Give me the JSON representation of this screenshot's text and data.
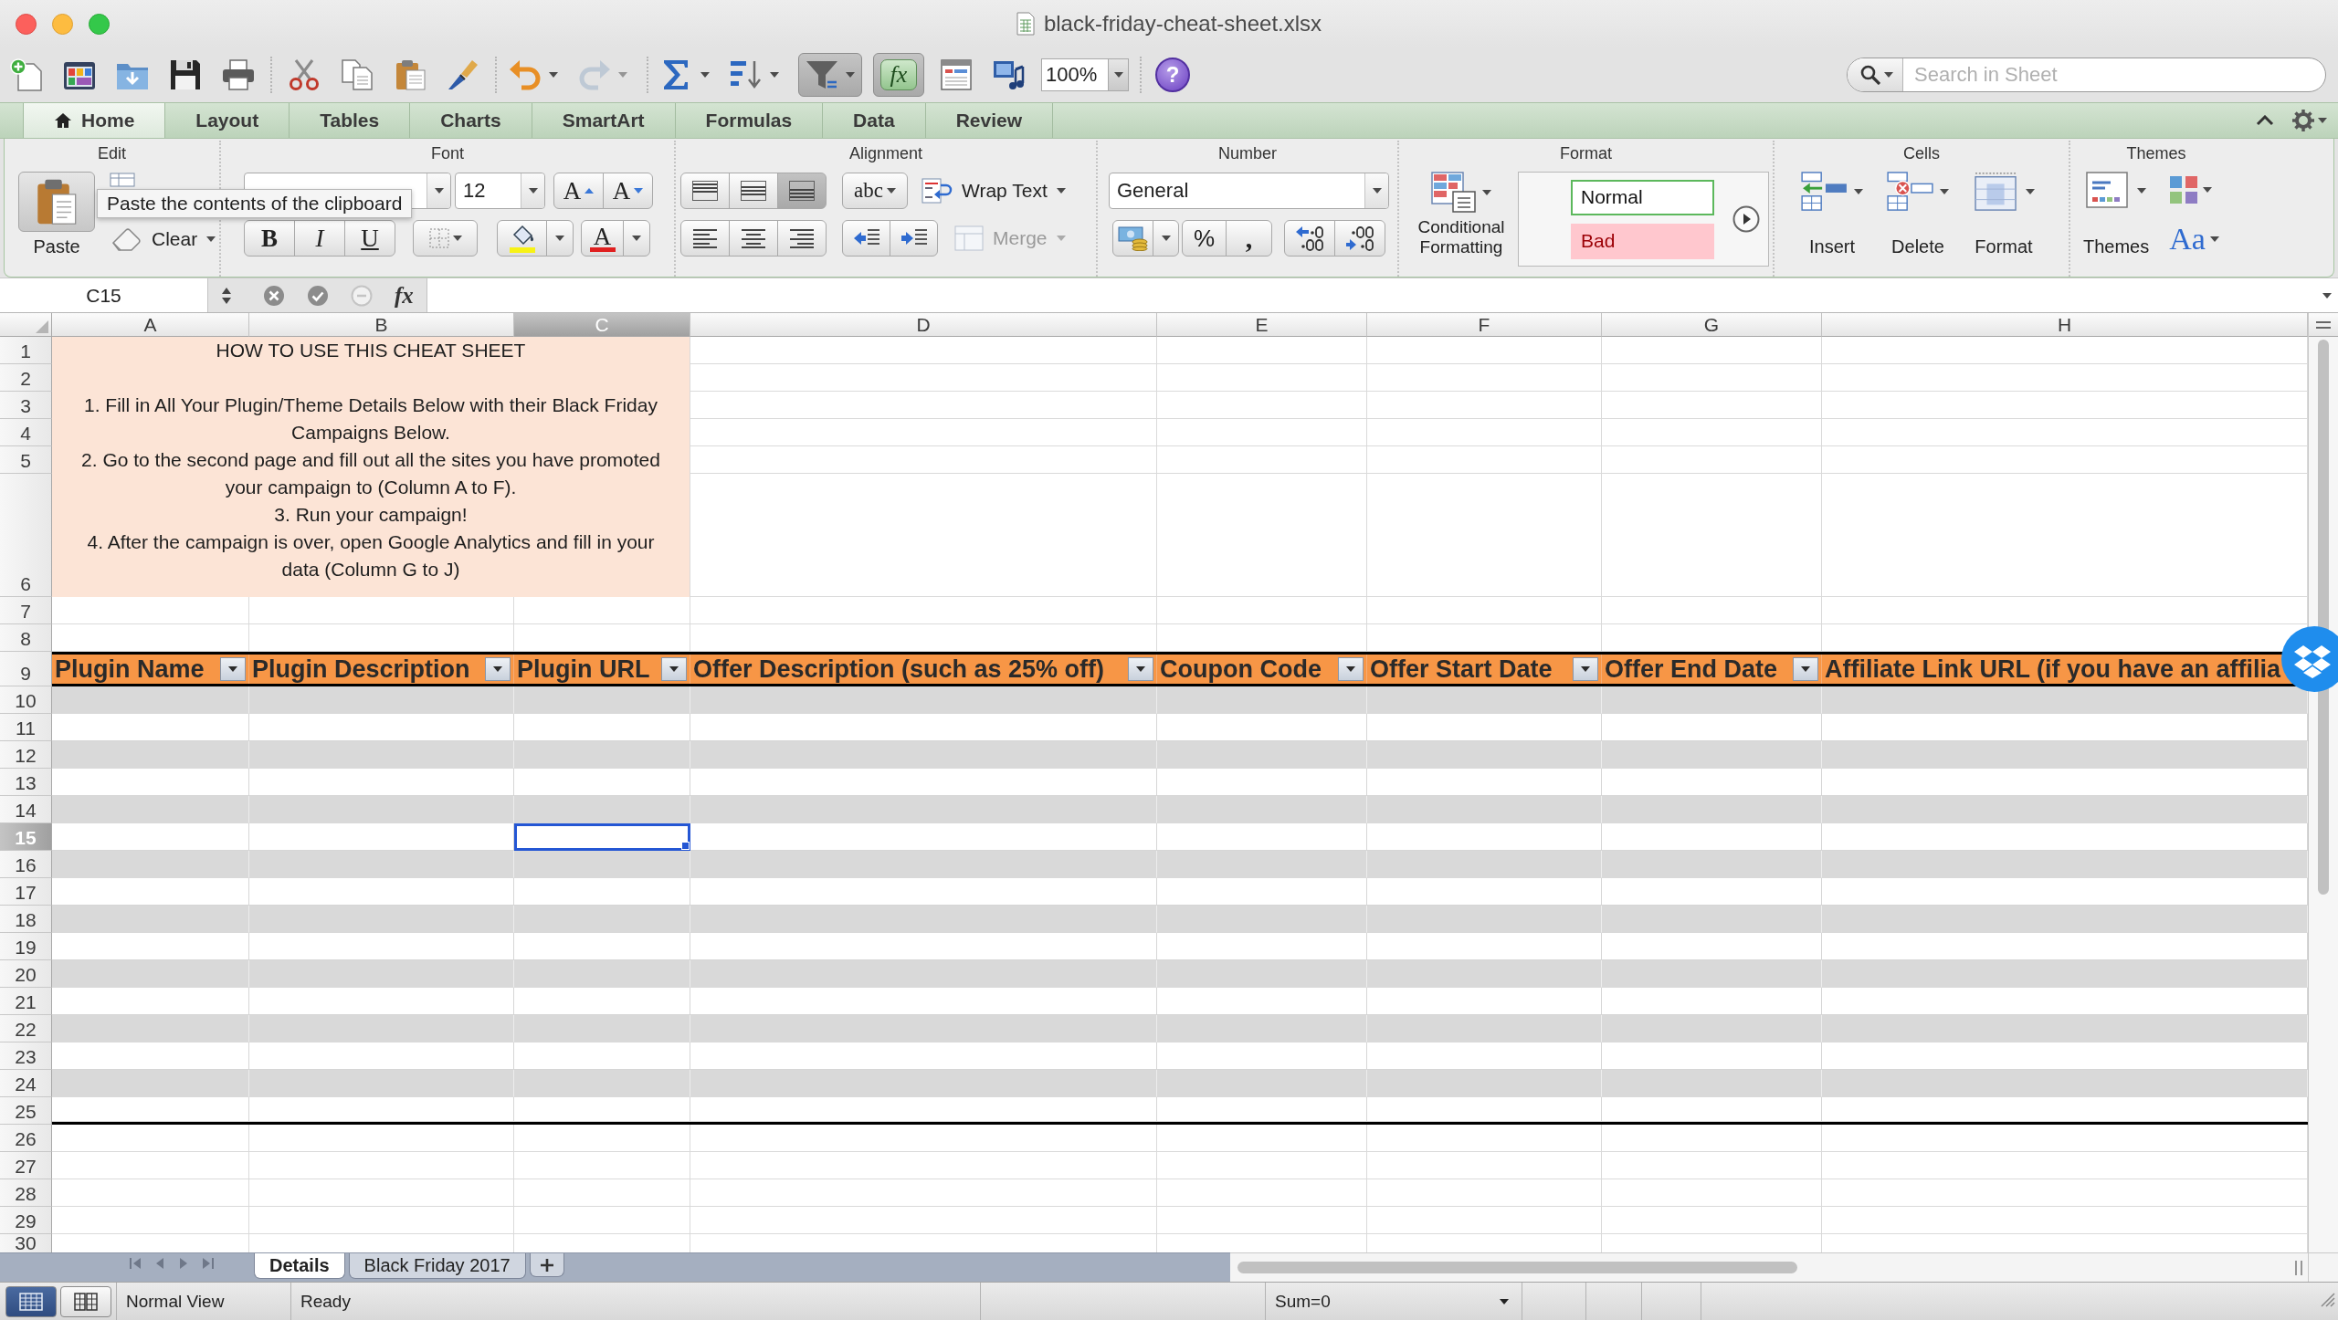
{
  "window": {
    "title": "black-friday-cheat-sheet.xlsx"
  },
  "toolbar": {
    "items": [
      {
        "kind": "new",
        "pressed": false,
        "disabled": false,
        "menu": false
      },
      {
        "kind": "gallery",
        "pressed": false,
        "disabled": false,
        "menu": false
      },
      {
        "kind": "open",
        "pressed": false,
        "disabled": false,
        "menu": false
      },
      {
        "kind": "save",
        "pressed": false,
        "disabled": false,
        "menu": false
      },
      {
        "kind": "print",
        "pressed": false,
        "disabled": false,
        "menu": false
      },
      {
        "kind": "separator"
      },
      {
        "kind": "cut",
        "pressed": false,
        "disabled": false,
        "menu": false
      },
      {
        "kind": "copy",
        "pressed": false,
        "disabled": false,
        "menu": false
      },
      {
        "kind": "paste",
        "pressed": false,
        "disabled": false,
        "menu": false
      },
      {
        "kind": "format-painter",
        "pressed": false,
        "disabled": false,
        "menu": false
      },
      {
        "kind": "separator"
      },
      {
        "kind": "undo",
        "pressed": false,
        "disabled": false,
        "menu": true
      },
      {
        "kind": "redo",
        "pressed": false,
        "disabled": true,
        "menu": true
      },
      {
        "kind": "separator"
      },
      {
        "kind": "sum",
        "pressed": false,
        "disabled": false,
        "menu": true
      },
      {
        "kind": "sort",
        "pressed": false,
        "disabled": false,
        "menu": true
      },
      {
        "kind": "filter",
        "pressed": true,
        "disabled": false,
        "menu": true
      },
      {
        "kind": "formula-builder",
        "label": "fx",
        "pressed": true,
        "disabled": false,
        "menu": false
      },
      {
        "kind": "toolbox",
        "pressed": false,
        "disabled": false,
        "menu": false
      },
      {
        "kind": "media",
        "pressed": false,
        "disabled": false,
        "menu": false
      },
      {
        "kind": "zoom",
        "value": "100%"
      },
      {
        "kind": "separator"
      },
      {
        "kind": "help",
        "label": "?",
        "pressed": false,
        "disabled": false,
        "menu": false
      }
    ],
    "search": {
      "placeholder": "Search in Sheet"
    }
  },
  "ribbon": {
    "tabs": [
      {
        "label": "Home",
        "selected": true
      },
      {
        "label": "Layout",
        "selected": false
      },
      {
        "label": "Tables",
        "selected": false
      },
      {
        "label": "Charts",
        "selected": false
      },
      {
        "label": "SmartArt",
        "selected": false
      },
      {
        "label": "Formulas",
        "selected": false
      },
      {
        "label": "Data",
        "selected": false
      },
      {
        "label": "Review",
        "selected": false
      }
    ],
    "edit": {
      "title": "Edit",
      "paste": "Paste",
      "clear": "Clear"
    },
    "font": {
      "title": "Font",
      "size": "12",
      "grow": "A",
      "shrink": "A",
      "bold": "B",
      "italic": "I",
      "underline": "U",
      "font_color_letter": "A"
    },
    "alignment": {
      "title": "Alignment",
      "vertical": [
        {
          "selected": false
        },
        {
          "selected": false
        },
        {
          "selected": true
        }
      ],
      "orientation": "abc",
      "wrap_text": "Wrap Text",
      "merge": {
        "label": "Merge",
        "disabled": true
      }
    },
    "number": {
      "title": "Number",
      "format": "General",
      "percent": "%",
      "comma": ","
    },
    "format": {
      "title": "Format",
      "conditional": "Conditional Formatting",
      "styles": [
        {
          "label": "Normal",
          "kind": "normal",
          "selected": true
        },
        {
          "label": "Bad",
          "kind": "bad",
          "selected": false
        }
      ]
    },
    "cells": {
      "title": "Cells",
      "buttons": [
        {
          "label": "Insert",
          "kind": "insert"
        },
        {
          "label": "Delete",
          "kind": "delete"
        },
        {
          "label": "Format",
          "kind": "format"
        }
      ]
    },
    "themes": {
      "title": "Themes",
      "themes": "Themes",
      "fonts": "Aa"
    }
  },
  "tooltip": "Paste the contents of the clipboard",
  "formula_bar": {
    "name_box": "C15",
    "function_button": "fx"
  },
  "sheet": {
    "columns": [
      {
        "label": "A",
        "selected": false
      },
      {
        "label": "B",
        "selected": false
      },
      {
        "label": "C",
        "selected": true
      },
      {
        "label": "D",
        "selected": false
      },
      {
        "label": "E",
        "selected": false
      },
      {
        "label": "F",
        "selected": false
      },
      {
        "label": "G",
        "selected": false
      },
      {
        "label": "H",
        "selected": false
      }
    ],
    "rows": [
      {
        "label": "1",
        "kind": "note",
        "selected": false
      },
      {
        "label": "2",
        "kind": "note",
        "selected": false
      },
      {
        "label": "3",
        "kind": "note",
        "selected": false
      },
      {
        "label": "4",
        "kind": "note",
        "selected": false
      },
      {
        "label": "5",
        "kind": "note",
        "selected": false
      },
      {
        "label": "6",
        "kind": "note",
        "selected": false
      },
      {
        "label": "7",
        "kind": "blank",
        "selected": false
      },
      {
        "label": "8",
        "kind": "blank",
        "selected": false
      },
      {
        "label": "9",
        "kind": "table-header",
        "selected": false
      },
      {
        "label": "10",
        "kind": "table-row",
        "selected": false
      },
      {
        "label": "11",
        "kind": "table-row",
        "selected": false
      },
      {
        "label": "12",
        "kind": "table-row",
        "selected": false
      },
      {
        "label": "13",
        "kind": "table-row",
        "selected": false
      },
      {
        "label": "14",
        "kind": "table-row",
        "selected": false
      },
      {
        "label": "15",
        "kind": "table-row",
        "selected": true
      },
      {
        "label": "16",
        "kind": "table-row",
        "selected": false
      },
      {
        "label": "17",
        "kind": "table-row",
        "selected": false
      },
      {
        "label": "18",
        "kind": "table-row",
        "selected": false
      },
      {
        "label": "19",
        "kind": "table-row",
        "selected": false
      },
      {
        "label": "20",
        "kind": "table-row",
        "selected": false
      },
      {
        "label": "21",
        "kind": "table-row",
        "selected": false
      },
      {
        "label": "22",
        "kind": "table-row",
        "selected": false
      },
      {
        "label": "23",
        "kind": "table-row",
        "selected": false
      },
      {
        "label": "24",
        "kind": "table-row",
        "selected": false
      },
      {
        "label": "25",
        "kind": "table-row",
        "selected": false
      },
      {
        "label": "26",
        "kind": "blank",
        "selected": false
      },
      {
        "label": "27",
        "kind": "blank",
        "selected": false
      },
      {
        "label": "28",
        "kind": "blank",
        "selected": false
      },
      {
        "label": "29",
        "kind": "blank",
        "selected": false
      },
      {
        "label": "30",
        "kind": "blank",
        "selected": false
      }
    ],
    "instructions": {
      "title": "HOW TO USE THIS CHEAT SHEET",
      "steps": [
        "1. Fill in All Your Plugin/Theme Details Below with their Black Friday Campaigns Below.",
        "2. Go to the second page and fill out all the sites you have promoted your campaign to (Column A to F).",
        "3. Run your campaign!",
        "4. After the campaign is over, open Google Analytics and fill in your data (Column G to J)"
      ]
    },
    "table": {
      "headers": [
        {
          "label": "Plugin Name",
          "filter": true
        },
        {
          "label": "Plugin Description",
          "filter": true
        },
        {
          "label": "Plugin URL",
          "filter": true
        },
        {
          "label": "Offer Description (such as 25% off)",
          "filter": true
        },
        {
          "label": "Coupon Code",
          "filter": true
        },
        {
          "label": "Offer Start Date",
          "filter": true
        },
        {
          "label": "Offer End Date",
          "filter": true
        },
        {
          "label": "Affiliate Link URL (if you have an affilia",
          "filter": false
        }
      ]
    }
  },
  "sheet_tabs": [
    {
      "label": "Details",
      "selected": true
    },
    {
      "label": "Black Friday 2017",
      "selected": false
    }
  ],
  "status_bar": {
    "views": [
      {
        "kind": "normal",
        "selected": true
      },
      {
        "kind": "page-layout",
        "selected": false
      }
    ],
    "view_name": "Normal View",
    "mode": "Ready",
    "sum": "Sum=0"
  }
}
